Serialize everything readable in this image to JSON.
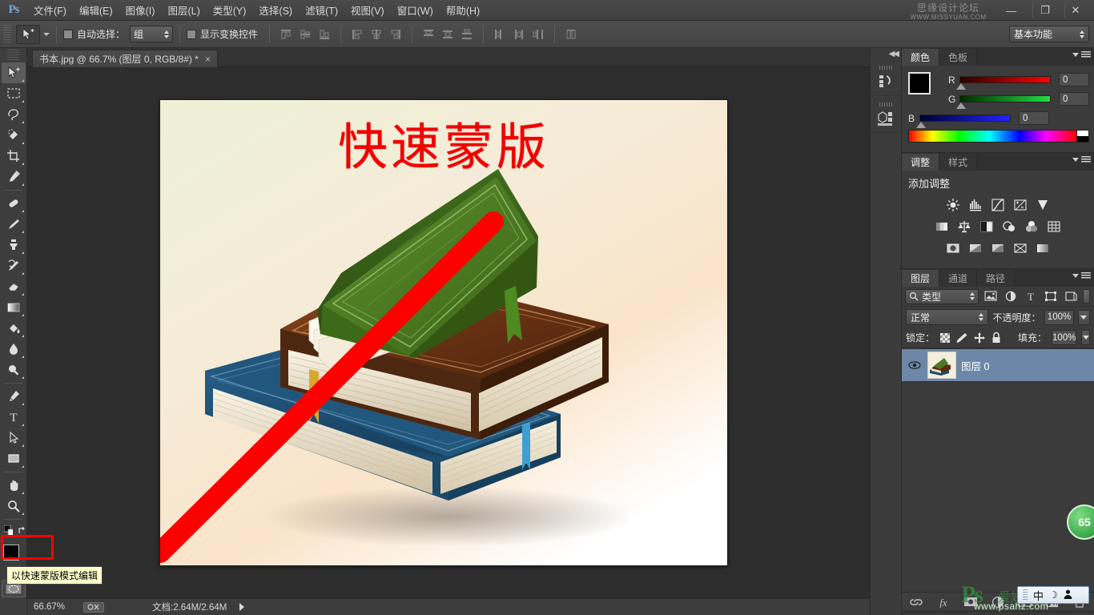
{
  "app": {
    "logo": "Ps",
    "watermark_top": {
      "cn": "思缘设计论坛",
      "url": "WWW.MISSYUAN.COM"
    },
    "watermark_bottom": {
      "ps": "Ps",
      "cn": "爱好者",
      "url": "www.psahz.com"
    }
  },
  "menubar": {
    "items": [
      {
        "label": "文件(F)"
      },
      {
        "label": "编辑(E)"
      },
      {
        "label": "图像(I)"
      },
      {
        "label": "图层(L)"
      },
      {
        "label": "类型(Y)"
      },
      {
        "label": "选择(S)"
      },
      {
        "label": "滤镜(T)"
      },
      {
        "label": "视图(V)"
      },
      {
        "label": "窗口(W)"
      },
      {
        "label": "帮助(H)"
      }
    ],
    "window_controls": {
      "minimize": "—",
      "maximize": "❐",
      "close": "✕"
    }
  },
  "optionsbar": {
    "tool_icon": "move-tool-icon",
    "auto_select_label": "自动选择：",
    "auto_select_value": "组",
    "show_transform_label": "显示变换控件",
    "workspace": "基本功能",
    "align_groups": [
      [
        "align-top-edges-icon",
        "align-vertical-centers-icon",
        "align-bottom-edges-icon"
      ],
      [
        "align-left-edges-icon",
        "align-horizontal-centers-icon",
        "align-right-edges-icon"
      ],
      [
        "distribute-top-icon",
        "distribute-vertical-center-icon",
        "distribute-bottom-icon"
      ],
      [
        "distribute-left-icon",
        "distribute-horizontal-center-icon",
        "distribute-right-icon"
      ],
      [
        "auto-align-layers-icon"
      ]
    ]
  },
  "toolbar": {
    "tools": [
      {
        "name": "move-tool",
        "glyph": "move",
        "selected": true
      },
      {
        "name": "rectangular-marquee-tool",
        "glyph": "marquee"
      },
      {
        "name": "lasso-tool",
        "glyph": "lasso"
      },
      {
        "name": "quick-selection-tool",
        "glyph": "quickselect"
      },
      {
        "name": "crop-tool",
        "glyph": "crop"
      },
      {
        "name": "eyedropper-tool",
        "glyph": "eyedropper"
      },
      {
        "name": "spot-healing-brush-tool",
        "glyph": "healing"
      },
      {
        "name": "brush-tool",
        "glyph": "brush"
      },
      {
        "name": "clone-stamp-tool",
        "glyph": "stamp"
      },
      {
        "name": "history-brush-tool",
        "glyph": "historybrush"
      },
      {
        "name": "eraser-tool",
        "glyph": "eraser"
      },
      {
        "name": "gradient-tool",
        "glyph": "gradient"
      },
      {
        "name": "paint-bucket-tool",
        "glyph": "bucket"
      },
      {
        "name": "blur-tool",
        "glyph": "blur"
      },
      {
        "name": "dodge-tool",
        "glyph": "dodge"
      },
      {
        "name": "pen-tool",
        "glyph": "pen"
      },
      {
        "name": "horizontal-type-tool",
        "glyph": "type"
      },
      {
        "name": "path-selection-tool",
        "glyph": "pathselect"
      },
      {
        "name": "rectangle-tool",
        "glyph": "shape"
      },
      {
        "name": "hand-tool",
        "glyph": "hand"
      },
      {
        "name": "zoom-tool",
        "glyph": "zoom"
      }
    ],
    "foreground_color": "#000000",
    "background_color": "#ffffff",
    "quick_mask_name": "edit-in-quick-mask-mode"
  },
  "document_tab": {
    "label": "书本.jpg @ 66.7% (图层 0, RGB/8#) *",
    "close": "×"
  },
  "canvas": {
    "title_text": "快速蒙版",
    "title_color": "#f10000",
    "background_gradient": [
      "#eef0d8",
      "#f9e6cf",
      "#ffffff"
    ],
    "books": [
      {
        "name": "green-book",
        "color": "#4a7a22"
      },
      {
        "name": "brown-book",
        "color": "#5e2d12"
      },
      {
        "name": "blue-book",
        "color": "#1d4a6e"
      }
    ],
    "annotation_arrow_color": "#ff0000"
  },
  "statusbar": {
    "zoom": "66.67%",
    "doc_info": "文档:2.64M/2.64M",
    "arrow": "▶"
  },
  "rail": {
    "collapse_icon": "double-left-arrow-icon",
    "buttons": [
      {
        "name": "history-panel-icon"
      },
      {
        "name": "mini-bridge-panel-icon"
      }
    ]
  },
  "color_panel": {
    "tabs": [
      {
        "label": "颜色",
        "active": true
      },
      {
        "label": "色板",
        "active": false
      }
    ],
    "channels": [
      {
        "label": "R",
        "value": "0"
      },
      {
        "label": "G",
        "value": "0"
      },
      {
        "label": "B",
        "value": "0"
      }
    ],
    "foreground": "#000000",
    "background": "#ffffff"
  },
  "adjustments_panel": {
    "tabs": [
      {
        "label": "调整",
        "active": true
      },
      {
        "label": "样式",
        "active": false
      }
    ],
    "title": "添加调整",
    "row1": [
      "brightness-contrast-icon",
      "levels-icon",
      "curves-icon",
      "exposure-icon",
      "vibrance-icon"
    ],
    "row2": [
      "hue-saturation-icon",
      "color-balance-icon",
      "black-white-icon",
      "photo-filter-icon",
      "channel-mixer-icon",
      "color-lookup-icon"
    ],
    "row3": [
      "invert-icon",
      "posterize-icon",
      "threshold-icon",
      "gradient-map-icon",
      "selective-color-icon"
    ]
  },
  "layers_panel": {
    "tabs": [
      {
        "label": "图层",
        "active": true
      },
      {
        "label": "通道",
        "active": false
      },
      {
        "label": "路径",
        "active": false
      }
    ],
    "filter_label": "类型",
    "filter_icons": [
      "filter-pixel-icon",
      "filter-adjustment-icon",
      "filter-type-icon",
      "filter-shape-icon",
      "filter-smartobject-icon"
    ],
    "blend_mode": "正常",
    "opacity_label": "不透明度：",
    "opacity_value": "100%",
    "lock_label": "锁定：",
    "lock_icons": [
      "lock-transparent-pixels-icon",
      "lock-image-pixels-icon",
      "lock-position-icon",
      "lock-all-icon"
    ],
    "fill_label": "填充：",
    "fill_value": "100%",
    "layers": [
      {
        "name": "图层 0",
        "visible": true,
        "selected": true
      }
    ],
    "footer_buttons": [
      "link-layers-icon",
      "layer-style-fx-icon",
      "add-layer-mask-icon",
      "new-adjustment-layer-icon",
      "new-group-icon",
      "new-layer-icon",
      "delete-layer-icon"
    ]
  },
  "tooltip": {
    "text": "以快速蒙版模式编辑"
  },
  "overlays": {
    "green_badge": "65",
    "ime": {
      "language": "中",
      "moon": "☽",
      "person": "👤"
    }
  }
}
